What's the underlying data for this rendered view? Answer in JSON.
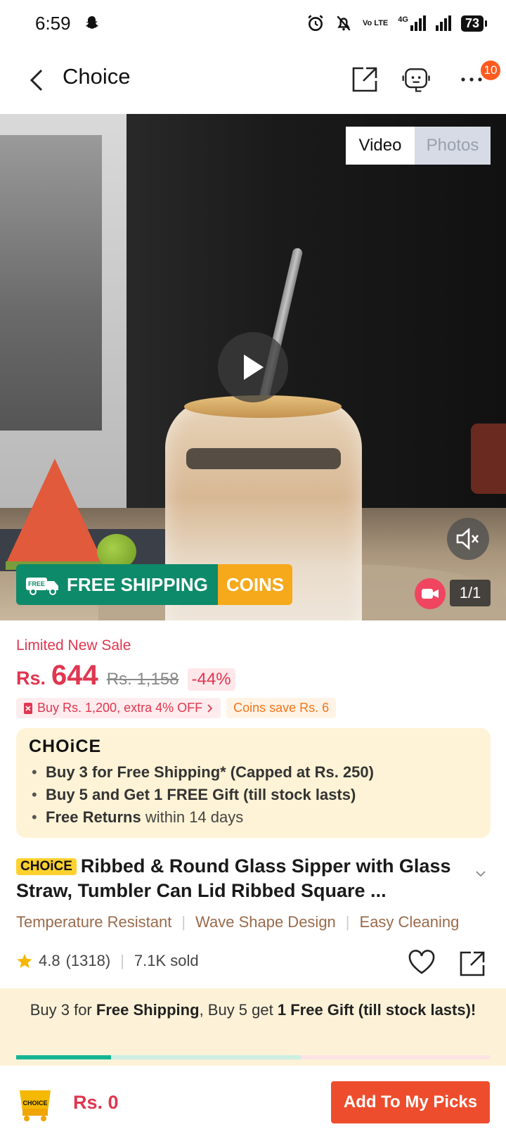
{
  "status_bar": {
    "time": "6:59",
    "network": "4G",
    "lte_label": "Vo LTE",
    "battery": "73"
  },
  "header": {
    "title": "Choice",
    "notification_count": "10"
  },
  "media": {
    "tabs": [
      {
        "label": "Video",
        "active": true
      },
      {
        "label": "Photos",
        "active": false
      }
    ],
    "free_shipping_label": "FREE SHIPPING",
    "free_tag": "FREE",
    "coins_label": "COINS",
    "counter": "1/1"
  },
  "price": {
    "sale_label": "Limited New Sale",
    "currency": "Rs.",
    "current": "644",
    "original": "Rs. 1,158",
    "discount": "-44%"
  },
  "promos": [
    {
      "text": "Buy Rs. 1,200, extra 4% OFF"
    },
    {
      "text": "Coins save Rs. 6"
    }
  ],
  "choice_box": {
    "logo": "CHOiCE",
    "items": [
      {
        "bold": "Buy 3 for  Free Shipping* (Capped at Rs. 250)",
        "rest": ""
      },
      {
        "bold": "Buy 5 and Get 1 FREE Gift (till stock lasts)",
        "rest": ""
      },
      {
        "bold": "Free Returns",
        "rest": " within 14 days"
      }
    ]
  },
  "product": {
    "tag": "CHOiCE",
    "title": "Ribbed & Round Glass Sipper with Glass Straw, Tumbler Can Lid Ribbed Square ...",
    "features": [
      "Temperature Resistant",
      "Wave Shape Design",
      "Easy Cleaning"
    ],
    "rating": "4.8",
    "reviews": "(1318)",
    "sold": "7.1K sold"
  },
  "bundle": {
    "part1": "Buy 3 for ",
    "bold1": "Free Shipping",
    "part2": ", Buy 5 get ",
    "bold2": "1 Free Gift (till stock lasts)!",
    "progress_fraction": 0.2
  },
  "bottom": {
    "cart_badge": "CHOICE",
    "price": "Rs. 0",
    "add_button": "Add To My Picks"
  },
  "colors": {
    "accent": "#ee4d2d",
    "price": "#e0364f",
    "shipping": "#0d8a6a",
    "coins": "#f5a91b"
  }
}
